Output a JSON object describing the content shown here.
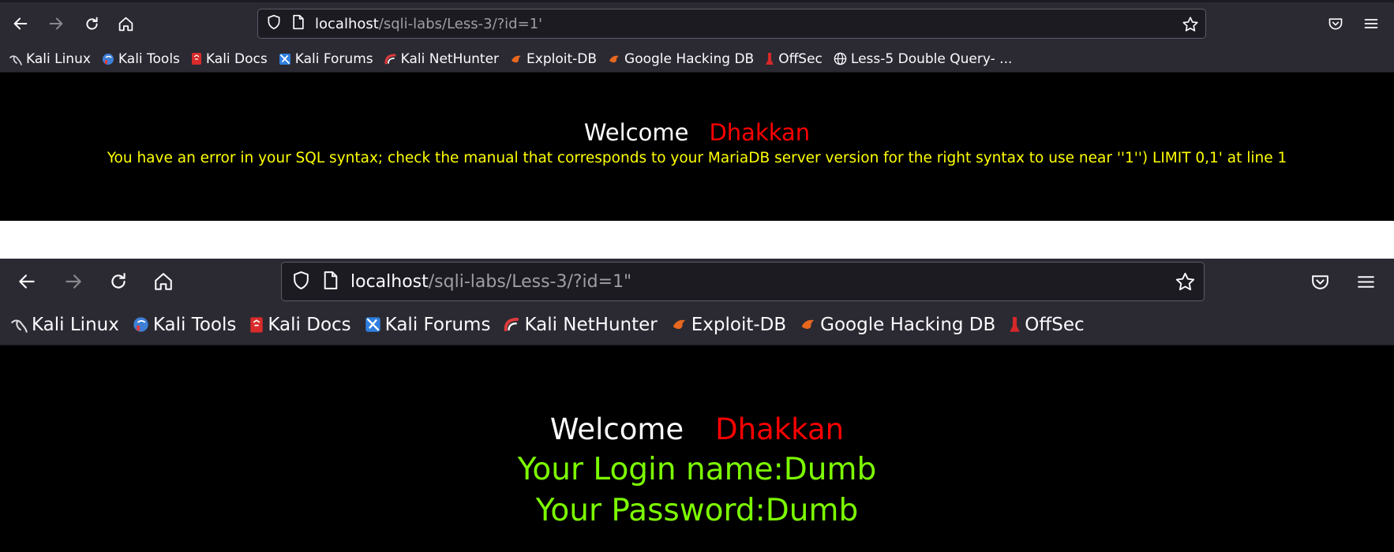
{
  "colors": {
    "toolbar": "#2b2a33",
    "urlbar": "#1c1b22",
    "page_bg": "#000000",
    "welcome": "#ffffff",
    "name": "#ff0000",
    "error": "#ffff00",
    "success": "#7cfc00"
  },
  "window1": {
    "url_host": "localhost",
    "url_path": "/sqli-labs/Less-3/?id=1'",
    "bookmarks": [
      {
        "label": "Kali Linux",
        "icon": "kali-dragon-icon"
      },
      {
        "label": "Kali Tools",
        "icon": "kali-tools-icon"
      },
      {
        "label": "Kali Docs",
        "icon": "kali-docs-icon"
      },
      {
        "label": "Kali Forums",
        "icon": "kali-forums-icon"
      },
      {
        "label": "Kali NetHunter",
        "icon": "nethunter-icon"
      },
      {
        "label": "Exploit-DB",
        "icon": "exploit-db-icon"
      },
      {
        "label": "Google Hacking DB",
        "icon": "ghdb-icon"
      },
      {
        "label": "OffSec",
        "icon": "offsec-icon"
      },
      {
        "label": "Less-5 Double Query- ...",
        "icon": "globe-icon"
      }
    ],
    "welcome": "Welcome",
    "name": "Dhakkan",
    "error": "You have an error in your SQL syntax; check the manual that corresponds to your MariaDB server version for the right syntax to use near ''1'') LIMIT 0,1' at line 1"
  },
  "window2": {
    "url_host": "localhost",
    "url_path": "/sqli-labs/Less-3/?id=1\"",
    "bookmarks": [
      {
        "label": "Kali Linux",
        "icon": "kali-dragon-icon"
      },
      {
        "label": "Kali Tools",
        "icon": "kali-tools-icon"
      },
      {
        "label": "Kali Docs",
        "icon": "kali-docs-icon"
      },
      {
        "label": "Kali Forums",
        "icon": "kali-forums-icon"
      },
      {
        "label": "Kali NetHunter",
        "icon": "nethunter-icon"
      },
      {
        "label": "Exploit-DB",
        "icon": "exploit-db-icon"
      },
      {
        "label": "Google Hacking DB",
        "icon": "ghdb-icon"
      },
      {
        "label": "OffSec",
        "icon": "offsec-icon"
      }
    ],
    "welcome": "Welcome",
    "name": "Dhakkan",
    "login_line": "Your Login name:Dumb",
    "password_line": "Your Password:Dumb"
  }
}
